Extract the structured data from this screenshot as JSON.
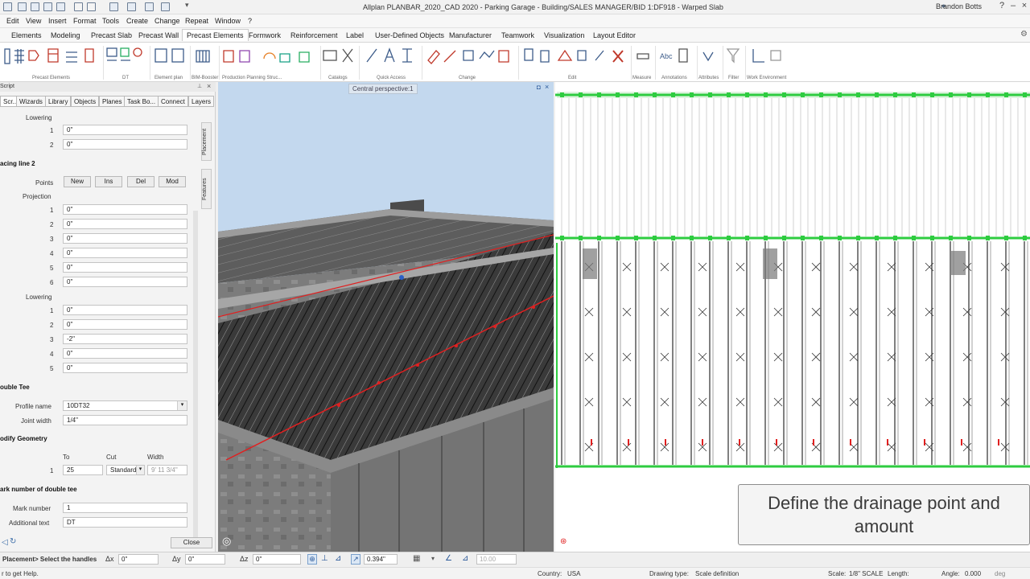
{
  "app": {
    "title": "Allplan PLANBAR_2020_CAD 2020 - Parking Garage - Building/SALES MANAGER/BID 1:DF918 - Warped Slab",
    "user": "Brandon Botts",
    "help_icon": "?"
  },
  "menu": [
    "Edit",
    "View",
    "Insert",
    "Format",
    "Tools",
    "Create",
    "Change",
    "Repeat",
    "Window",
    "?"
  ],
  "ribbon_tabs": [
    "Elements",
    "Modeling",
    "Precast Slab",
    "Precast Wall",
    "Precast Elements",
    "Formwork",
    "Reinforcement",
    "Label",
    "User-Defined Objects",
    "Manufacturer",
    "Teamwork",
    "Visualization",
    "Layout Editor"
  ],
  "ribbon_active_tab": "Precast Elements",
  "ribbon_groups": [
    "Precast Elements",
    "DT",
    "Element plan",
    "BIM-Booster",
    "Production Planning Struc...",
    "Catalogs",
    "Quick Access",
    "Change",
    "Edit",
    "Measure",
    "Annotations",
    "Attributes",
    "Filter",
    "Work Environment"
  ],
  "palette": {
    "title": "Script",
    "tabs": [
      "Scr...",
      "Wizards",
      "Library",
      "Objects",
      "Planes",
      "Task Bo...",
      "Connect",
      "Layers"
    ],
    "side_tabs": [
      "Placement",
      "Features"
    ],
    "lowering_top": {
      "label": "Lowering",
      "rows": [
        {
          "n": "1",
          "v": "0\""
        },
        {
          "n": "2",
          "v": "0\""
        }
      ]
    },
    "spacing_line": {
      "title": "acing line 2",
      "points_label": "Points",
      "buttons": [
        "New",
        "Ins",
        "Del",
        "Mod"
      ]
    },
    "projection": {
      "label": "Projection",
      "rows": [
        {
          "n": "1",
          "v": "0\""
        },
        {
          "n": "2",
          "v": "0\""
        },
        {
          "n": "3",
          "v": "0\""
        },
        {
          "n": "4",
          "v": "0\""
        },
        {
          "n": "5",
          "v": "0\""
        },
        {
          "n": "6",
          "v": "0\""
        }
      ]
    },
    "lowering": {
      "label": "Lowering",
      "rows": [
        {
          "n": "1",
          "v": "0\""
        },
        {
          "n": "2",
          "v": "0\""
        },
        {
          "n": "3",
          "v": "-2\""
        },
        {
          "n": "4",
          "v": "0\""
        },
        {
          "n": "5",
          "v": "0\""
        }
      ]
    },
    "double_tee": {
      "title": "ouble Tee",
      "profile_label": "Profile name",
      "profile_value": "10DT32",
      "joint_label": "Joint width",
      "joint_value": "1/4\""
    },
    "modify": {
      "title": "odify Geometry",
      "to_label": "To",
      "cut_label": "Cut",
      "width_label": "Width",
      "row_n": "1",
      "to_value": "25",
      "cut_value": "Standard",
      "width_value": "9' 11 3/4\""
    },
    "mark": {
      "title": "ark number of double tee",
      "mark_label": "Mark number",
      "mark_value": "1",
      "text_label": "Additional text",
      "text_value": "DT"
    },
    "close_label": "Close"
  },
  "viewport3d": {
    "label": "Central perspective:1"
  },
  "caption": "Define the drainage point and amount",
  "coordbar": {
    "prompt": "Placement> Select the handles",
    "dx_label": "Δx",
    "dx": "0\"",
    "dy_label": "Δy",
    "dy": "0\"",
    "dz_label": "Δz",
    "dz": "0\"",
    "size": "0.394\"",
    "angle": "10.00"
  },
  "statusbar": {
    "help": "r to get Help.",
    "country_label": "Country:",
    "country": "USA",
    "drawing_type_label": "Drawing type:",
    "drawing_type": "Scale definition",
    "scale_label": "Scale:",
    "scale": "1/8\" SCALE",
    "length_label": "Length:",
    "angle_label": "Angle:",
    "angle": "0.000",
    "angle_unit": "deg"
  },
  "colors": {
    "accent_tab": "#ffffff",
    "viewport_bg": "#bfd6ee",
    "red_line": "#e02020",
    "green_rail": "#2ecc40"
  }
}
